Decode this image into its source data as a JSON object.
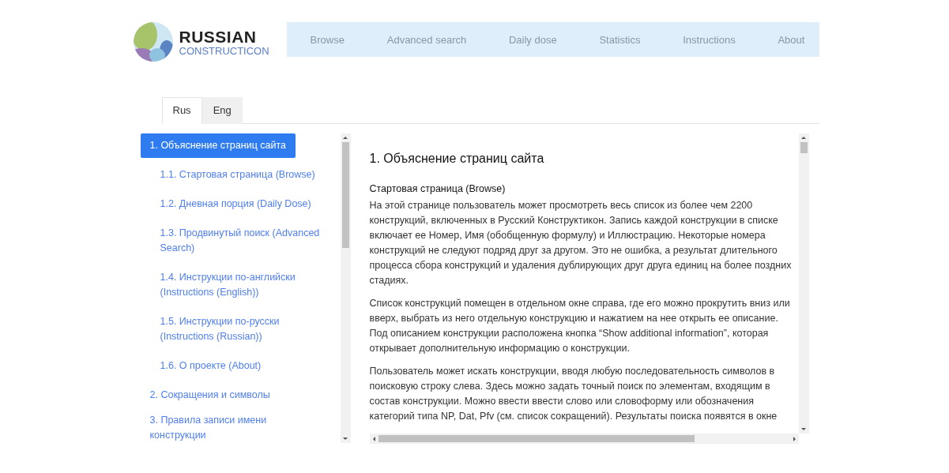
{
  "logo": {
    "title": "RUSSIAN",
    "subtitle": "CONSTRUCTICON"
  },
  "nav": [
    "Browse",
    "Advanced search",
    "Daily dose",
    "Statistics",
    "Instructions",
    "About"
  ],
  "tabs": [
    {
      "label": "Rus",
      "selected": true
    },
    {
      "label": "Eng",
      "selected": false
    }
  ],
  "sidebar": {
    "items": [
      {
        "label": "1. Объяснение страниц сайта",
        "selected": true,
        "children": [
          {
            "label": "1.1. Стартовая страница (Browse)",
            "selected": false
          },
          {
            "label": "1.2. Дневная порция (Daily Dose)",
            "selected": false
          },
          {
            "label": "1.3. Продвинутый поиск (Advanced Search)",
            "selected": false
          },
          {
            "label": "1.4. Инструкции по-английски (Instructions (English))",
            "selected": false
          },
          {
            "label": "1.5. Инструкции по-русски (Instructions (Russian))",
            "selected": false
          },
          {
            "label": "1.6. О проекте (About)",
            "selected": false
          }
        ]
      },
      {
        "label": "2. Сокращения и символы",
        "selected": false
      },
      {
        "label": "3. Правила записи имени конструкции",
        "selected": false
      }
    ]
  },
  "content": {
    "heading": "1. Объяснение страниц сайта",
    "subheading": "Стартовая страница (Browse)",
    "paragraphs": [
      "На этой странице пользователь может просмотреть весь список из более чем 2200 конструкций, включенных в Русский Конструктикон. Запись каждой конструкции в списке включает ее Номер, Имя (обобщенную формулу) и Иллюстрацию. Некоторые номера конструкций не следуют подряд друг за другом. Это не ошибка, а результат длительного процесса сбора конструкций и удаления дублирующих друг друга единиц на более поздних стадиях.",
      "Список конструкций помещен в отдельном окне справа, где его можно прокрутить вниз или вверх, выбрать из него отдельную конструкцию и нажатием на нее открыть ее описание. Под описанием конструкции расположена кнопка “Show additional information”, которая открывает дополнительную информацию о конструкции.",
      "Пользователь может искать конструкции, вводя любую последовательность символов в поисковую строку слева. Здесь можно задать точный поиск по элементам, входящим в состав конструкции. Можно ввести ввести слово или словоформу или обозначения категорий типа NP, Dat, Pfv (см. список сокращений). Результаты поиска появятся в окне"
    ]
  }
}
